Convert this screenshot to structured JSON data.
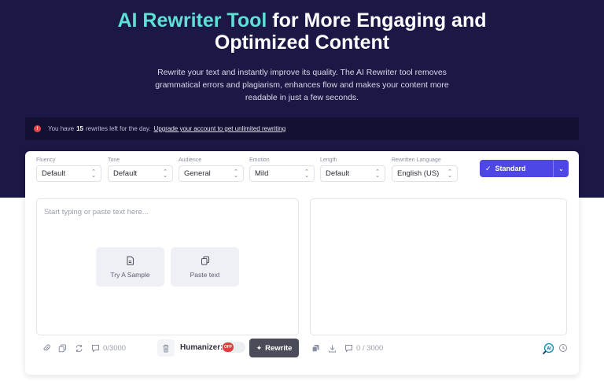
{
  "hero": {
    "title_accent": "AI Rewriter Tool",
    "title_rest_1": " for More Engaging and",
    "title_rest_2": "Optimized Content",
    "subtitle": "Rewrite your text and instantly improve its quality. The AI Rewriter tool removes grammatical errors and plagiarism, enhances flow and makes your content more readable in just a few seconds."
  },
  "notice": {
    "prefix": "You have",
    "count": "15",
    "suffix": "rewrites left for the day.",
    "link": "Upgrade your account to get unlimited rewriting"
  },
  "options": [
    {
      "label": "Fluency",
      "value": "Default"
    },
    {
      "label": "Tone",
      "value": "Default"
    },
    {
      "label": "Audience",
      "value": "General"
    },
    {
      "label": "Emotion",
      "value": "Mild"
    },
    {
      "label": "Length",
      "value": "Default"
    },
    {
      "label": "Rewritten Language",
      "value": "English (US)"
    }
  ],
  "mode": {
    "label": "Standard"
  },
  "editor": {
    "placeholder": "Start typing or paste text here...",
    "sample_label": "Try A Sample",
    "paste_label": "Paste text",
    "input_count": "0/3000",
    "humanizer_label": "Humanizer:",
    "humanizer_state": "OFF",
    "rewrite_label": "Rewrite",
    "output_count": "0 / 3000"
  },
  "colors": {
    "hero_bg": "#1c1846",
    "accent": "#5ee0d6",
    "primary_button": "#4f47e5",
    "toggle_off": "#e23c3c"
  }
}
